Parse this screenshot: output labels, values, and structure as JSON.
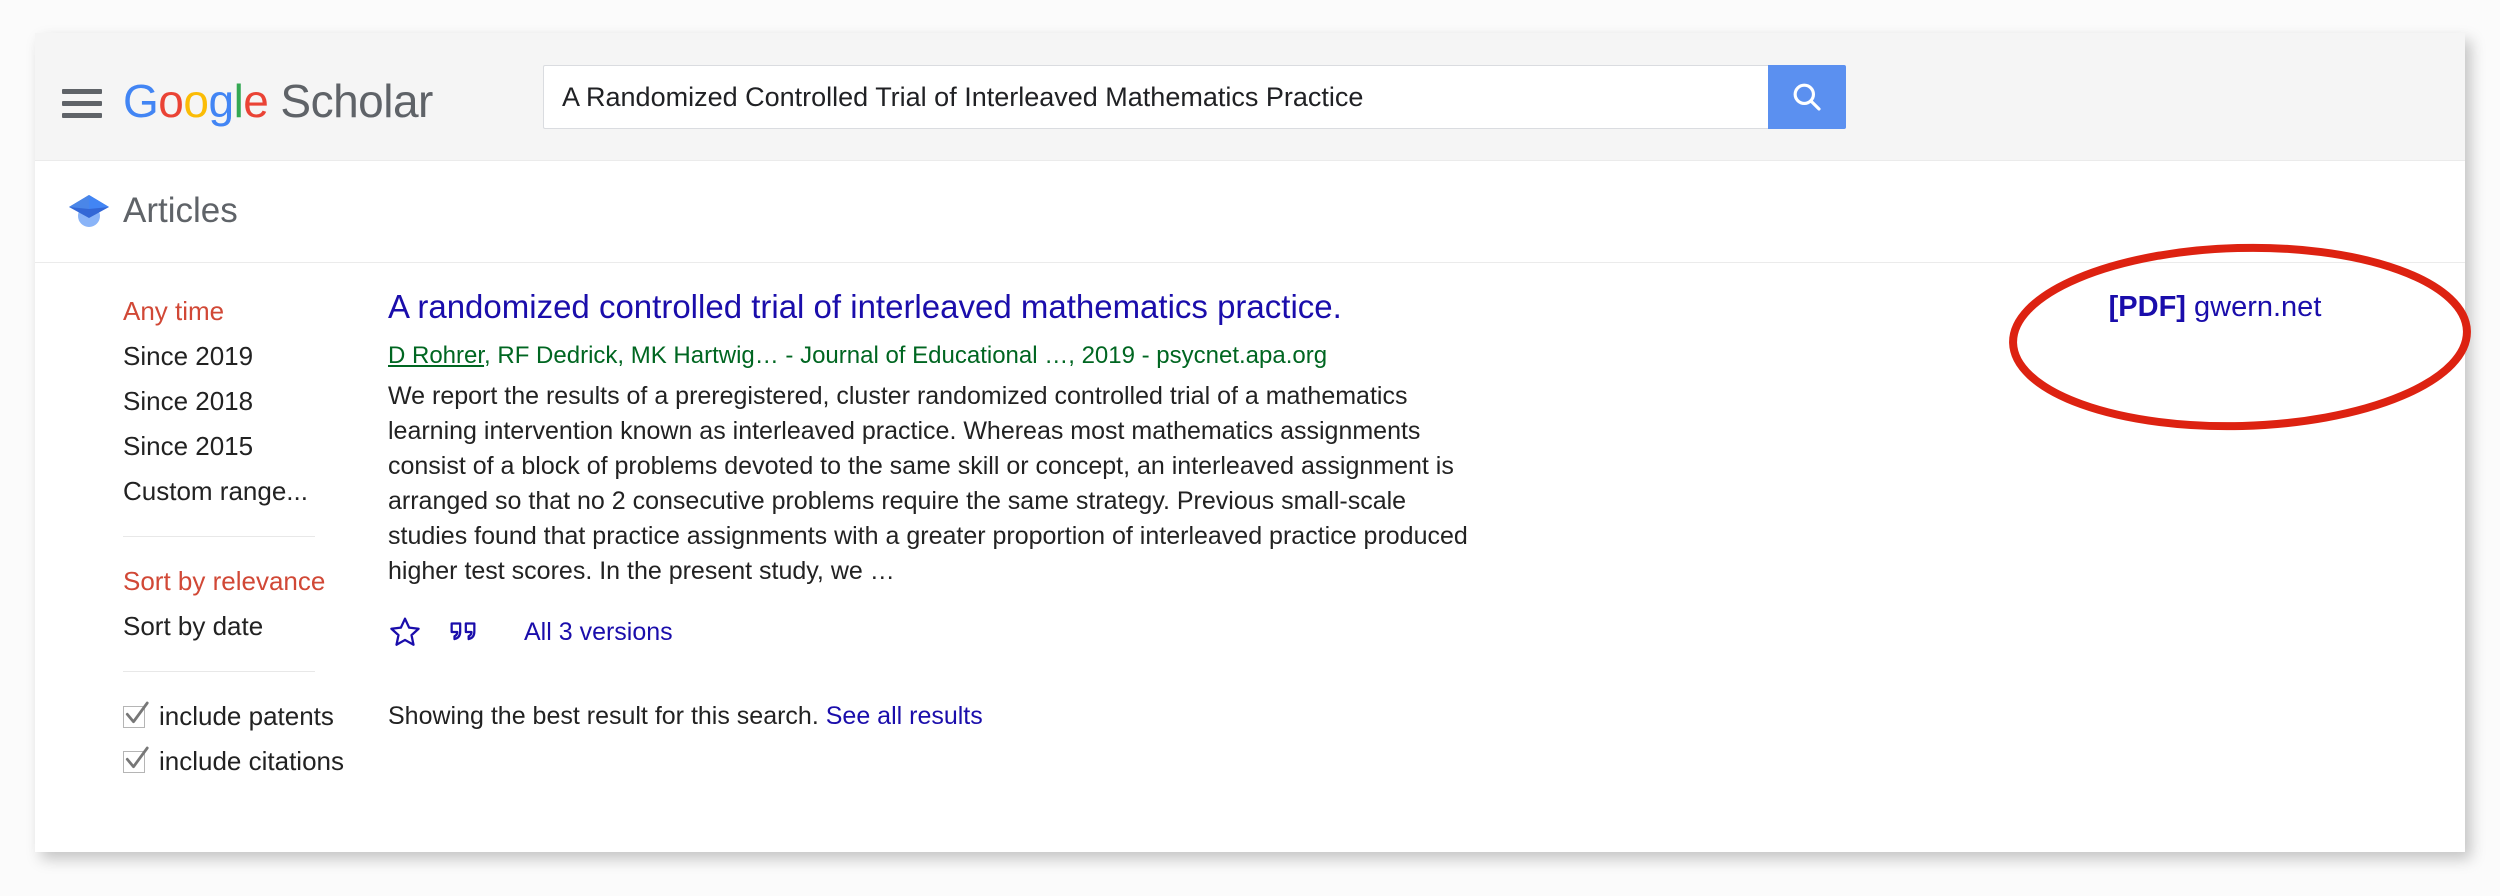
{
  "header": {
    "menu_icon": "hamburger-menu-icon",
    "logo": {
      "letters": [
        "G",
        "o",
        "o",
        "g",
        "l",
        "e"
      ],
      "word": "Scholar"
    },
    "search": {
      "value": "A Randomized Controlled Trial of Interleaved Mathematics Practice",
      "placeholder": "Search",
      "button_icon": "search-icon",
      "button_color": "#5b90f0"
    }
  },
  "articles_bar": {
    "icon": "graduation-cap-icon",
    "label": "Articles"
  },
  "sidebar": {
    "time_filters": [
      {
        "label": "Any time",
        "active": true
      },
      {
        "label": "Since 2019",
        "active": false
      },
      {
        "label": "Since 2018",
        "active": false
      },
      {
        "label": "Since 2015",
        "active": false
      },
      {
        "label": "Custom range...",
        "active": false
      }
    ],
    "sort_filters": [
      {
        "label": "Sort by relevance",
        "active": true
      },
      {
        "label": "Sort by date",
        "active": false
      }
    ],
    "checkboxes": [
      {
        "label": "include patents",
        "checked": true
      },
      {
        "label": "include citations",
        "checked": true
      }
    ],
    "active_color": "#d14836"
  },
  "result": {
    "title": "A randomized controlled trial of interleaved mathematics practice.",
    "meta_author_link": "D Rohrer",
    "meta_rest": ", RF Dedrick, MK Hartwig… - Journal of Educational …, 2019 - psycnet.apa.org",
    "snippet": "We report the results of a preregistered, cluster randomized controlled trial of a mathematics learning intervention known as interleaved practice. Whereas most mathematics assignments consist of a block of problems devoted to the same skill or concept, an interleaved assignment is arranged so that no 2 consecutive problems require the same strategy. Previous small-scale studies found that practice assignments with a greater proportion of interleaved practice produced higher test scores. In the present study, we …",
    "actions": {
      "save_icon": "star-icon",
      "cite_icon": "quote-icon",
      "versions_label": "All 3 versions"
    },
    "pdf": {
      "tag": "[PDF]",
      "domain": "gwern.net"
    },
    "link_color": "#1a0dab",
    "meta_color": "#006621"
  },
  "footer_note": {
    "text": "Showing the best result for this search.",
    "link": "See all results"
  },
  "annotation": {
    "shape": "red-ellipse-highlight",
    "color": "#dd2211",
    "target": "pdf-link"
  }
}
